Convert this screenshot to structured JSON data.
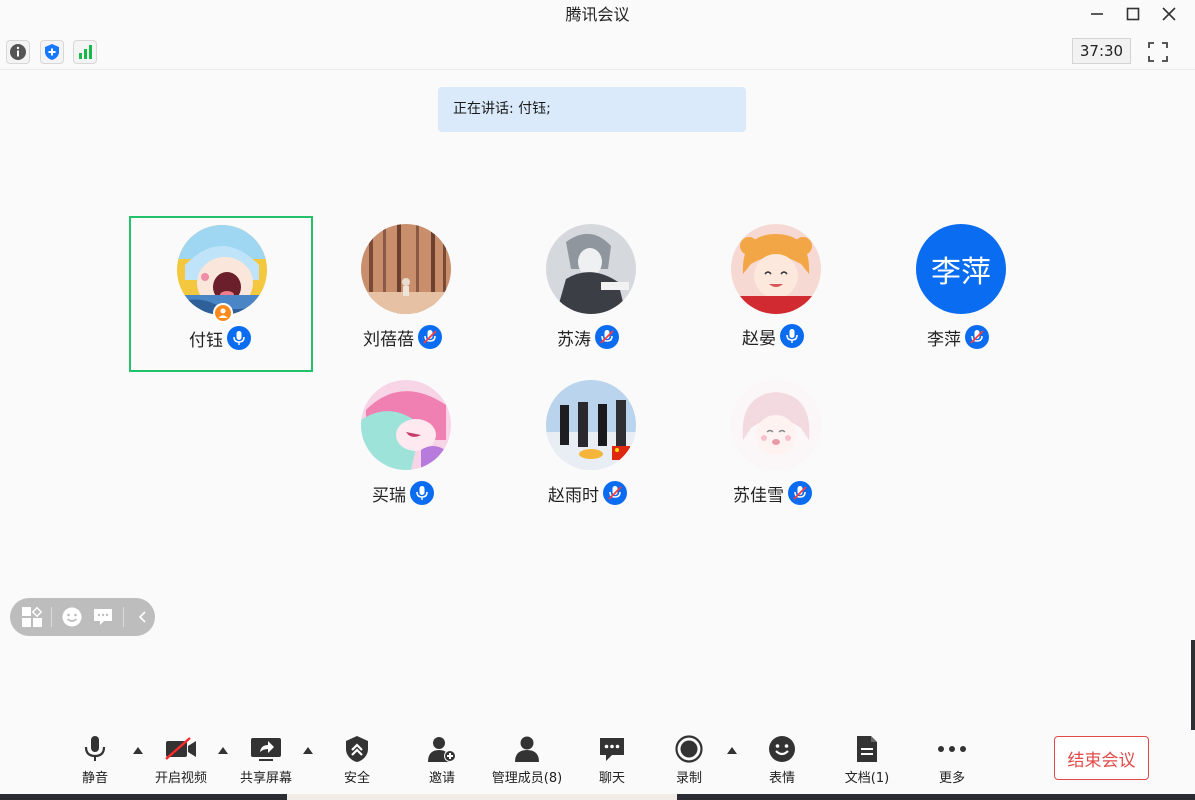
{
  "window": {
    "title": "腾讯会议"
  },
  "infobar": {
    "timer": "37:30"
  },
  "speaking": {
    "text": "正在讲话: 付钰;"
  },
  "participants": [
    {
      "name": "付钰"
    },
    {
      "name": "刘蓓蓓"
    },
    {
      "name": "苏涛"
    },
    {
      "name": "赵晏"
    },
    {
      "name": "李萍",
      "avatar_text": "李萍"
    },
    {
      "name": "买瑞"
    },
    {
      "name": "赵雨时"
    },
    {
      "name": "苏佳雪"
    }
  ],
  "toolbar": {
    "mute": "静音",
    "video": "开启视频",
    "share": "共享屏幕",
    "security": "安全",
    "invite": "邀请",
    "members": "管理成员(8)",
    "chat": "聊天",
    "record": "录制",
    "reactions": "表情",
    "docs": "文档(1)",
    "more": "更多",
    "end": "结束会议"
  },
  "colors": {
    "accent": "#0a6cf0",
    "active_border": "#22c16a",
    "end": "#e24a4a"
  }
}
